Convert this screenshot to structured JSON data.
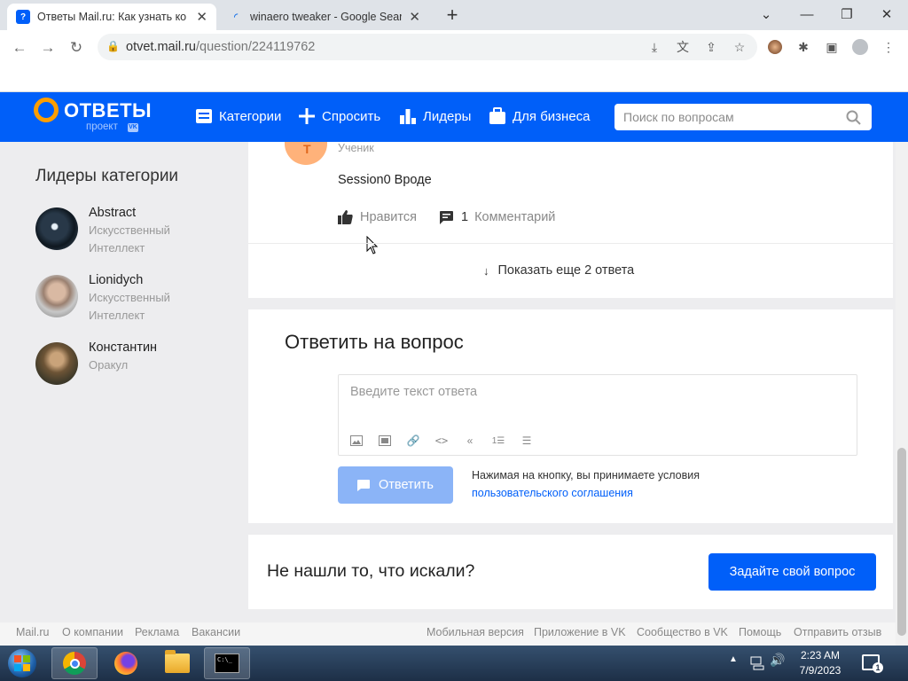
{
  "browser": {
    "tabs": [
      {
        "title": "Ответы Mail.ru: Как узнать ко",
        "active": true
      },
      {
        "title": "winaero tweaker - Google Sear",
        "active": false
      }
    ],
    "url_host": "otvet.mail.ru",
    "url_path": "/question/224119762"
  },
  "site": {
    "logo_text": "ОТВЕТЫ",
    "logo_sub": "проект",
    "logo_vk": "VK",
    "nav": [
      "Категории",
      "Спросить",
      "Лидеры",
      "Для бизнеса"
    ],
    "search_placeholder": "Поиск по вопросам"
  },
  "sidebar": {
    "title": "Лидеры категории",
    "leaders": [
      {
        "name": "Abstract",
        "role_line1": "Искусственный",
        "role_line2": "Интеллект"
      },
      {
        "name": "Lionidych",
        "role_line1": "Искусственный",
        "role_line2": "Интеллект"
      },
      {
        "name": "Константин",
        "role_line1": "Оракул",
        "role_line2": ""
      }
    ]
  },
  "answer": {
    "avatar_letter": "Т",
    "author_role": "Ученик",
    "text": "Session0 Вроде",
    "like_label": "Нравится",
    "comment_count": "1",
    "comment_label": "Комментарий",
    "more_label": "Показать еще 2 ответа"
  },
  "reply": {
    "title": "Ответить на вопрос",
    "placeholder": "Введите текст ответа",
    "button": "Ответить",
    "terms_line1": "Нажимая на кнопку, вы принимаете условия",
    "terms_link": "пользовательского соглашения"
  },
  "not_found": {
    "title": "Не нашли то, что искали?",
    "button": "Задайте свой вопрос"
  },
  "footer": {
    "left": [
      "Mail.ru",
      "О компании",
      "Реклама",
      "Вакансии"
    ],
    "right": [
      "Мобильная версия",
      "Приложение в VK",
      "Сообщество в VK",
      "Помощь",
      "Отправить отзыв"
    ]
  },
  "taskbar": {
    "time": "2:23 AM",
    "date": "7/9/2023",
    "notif_count": "1"
  },
  "colors": {
    "brand_blue": "#005ff9",
    "logo_orange": "#ff9e00",
    "disabled_button": "#8bb4f7"
  }
}
